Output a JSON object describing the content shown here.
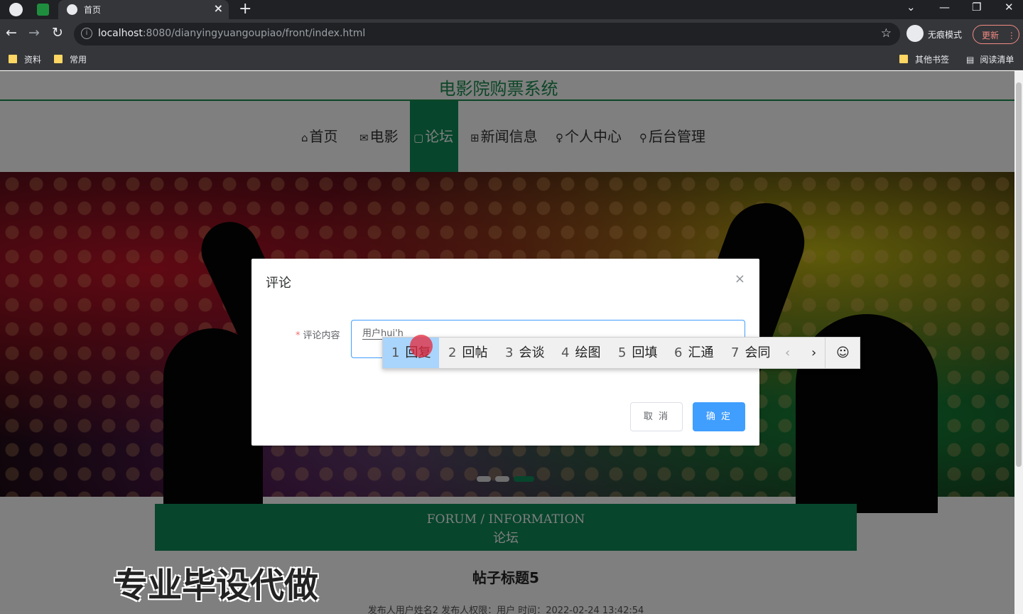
{
  "browser": {
    "tab_title": "首页",
    "new_tab": "+",
    "url_host": "localhost",
    "url_path": ":8080/dianyingyuangoupiao/front/index.html",
    "incognito_label": "无痕模式",
    "update_label": "更新",
    "bookmarks": [
      "资料",
      "常用"
    ],
    "other_bookmarks": "其他书签",
    "reading_list": "阅读清单"
  },
  "site": {
    "title": "电影院购票系统",
    "nav": [
      {
        "icon": "⌂",
        "label": "首页"
      },
      {
        "icon": "✉",
        "label": "电影"
      },
      {
        "icon": "▢",
        "label": "论坛"
      },
      {
        "icon": "⊞",
        "label": "新闻信息"
      },
      {
        "icon": "♀",
        "label": "个人中心"
      },
      {
        "icon": "⚲",
        "label": "后台管理"
      }
    ],
    "active_nav": "论坛",
    "carousel_active_index": 2,
    "forum_heading_en": "FORUM / INFORMATION",
    "forum_heading_cn": "论坛",
    "post_title": "帖子标题5",
    "post_meta": "发布人用户姓名2   发布人权限：用户   时间：2022-02-24 13:42:54",
    "watermark": "专业毕设代做"
  },
  "dialog": {
    "title": "评论",
    "close": "×",
    "field_label": "评论内容",
    "required_mark": "*",
    "field_value": "用户hui'h",
    "cancel": "取 消",
    "confirm": "确 定"
  },
  "ime": {
    "candidates": [
      {
        "num": "1",
        "text": "回复"
      },
      {
        "num": "2",
        "text": "回帖"
      },
      {
        "num": "3",
        "text": "会谈"
      },
      {
        "num": "4",
        "text": "绘图"
      },
      {
        "num": "5",
        "text": "回填"
      },
      {
        "num": "6",
        "text": "汇通"
      },
      {
        "num": "7",
        "text": "会同"
      }
    ],
    "prev": "‹",
    "next": "›",
    "emoji": "☺"
  },
  "colors": {
    "brand_green": "#0e8a58",
    "primary_blue": "#409eff",
    "ime_selected": "#a9d4fb"
  }
}
